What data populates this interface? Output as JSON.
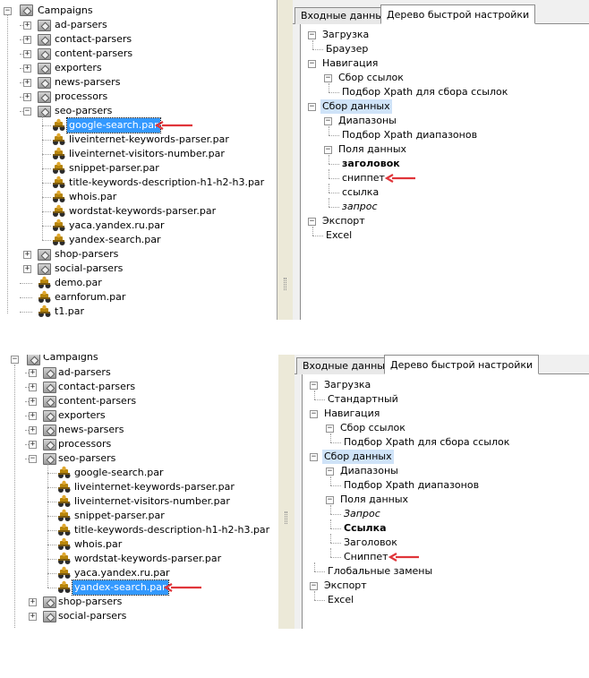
{
  "top": {
    "left_tree": {
      "root": "Campaigns",
      "folders": [
        "ad-parsers",
        "contact-parsers",
        "content-parsers",
        "exporters",
        "news-parsers",
        "processors",
        "seo-parsers"
      ],
      "seo_children": [
        "google-search.par",
        "liveinternet-keywords-parser.par",
        "liveinternet-visitors-number.par",
        "snippet-parser.par",
        "title-keywords-description-h1-h2-h3.par",
        "whois.par",
        "wordstat-keywords-parser.par",
        "yaca.yandex.ru.par",
        "yandex-search.par"
      ],
      "after_folders": [
        "shop-parsers",
        "social-parsers"
      ],
      "root_files": [
        "demo.par",
        "earnforum.par",
        "t1.par"
      ]
    },
    "tabs": [
      "Входные данные",
      "Дерево быстрой настройки"
    ],
    "settings_tree": [
      {
        "label": "Загрузка",
        "level": 0,
        "expander": true
      },
      {
        "label": "Браузер",
        "level": 1,
        "expander": false
      },
      {
        "label": "Навигация",
        "level": 0,
        "expander": true
      },
      {
        "label": "Сбор ссылок",
        "level": 1,
        "expander": true
      },
      {
        "label": "Подбор Xpath для сбора ссылок",
        "level": 2,
        "expander": false
      },
      {
        "label": "Сбор данных",
        "level": 0,
        "expander": true,
        "style": "highlight"
      },
      {
        "label": "Диапазоны",
        "level": 1,
        "expander": true
      },
      {
        "label": "Подбор Xpath диапазонов",
        "level": 2,
        "expander": false
      },
      {
        "label": "Поля данных",
        "level": 1,
        "expander": true
      },
      {
        "label": "заголовок",
        "level": 2,
        "expander": false,
        "style": "bold"
      },
      {
        "label": "сниппет",
        "level": 2,
        "expander": false
      },
      {
        "label": "ссылка",
        "level": 2,
        "expander": false
      },
      {
        "label": "запрос",
        "level": 2,
        "expander": false,
        "style": "italic"
      },
      {
        "label": "Экспорт",
        "level": 0,
        "expander": true
      },
      {
        "label": "Excel",
        "level": 1,
        "expander": false
      }
    ]
  },
  "bottom": {
    "left_tree": {
      "root": "Campaigns",
      "folders": [
        "ad-parsers",
        "contact-parsers",
        "content-parsers",
        "exporters",
        "news-parsers",
        "processors",
        "seo-parsers"
      ],
      "seo_children": [
        "google-search.par",
        "liveinternet-keywords-parser.par",
        "liveinternet-visitors-number.par",
        "snippet-parser.par",
        "title-keywords-description-h1-h2-h3.par",
        "whois.par",
        "wordstat-keywords-parser.par",
        "yaca.yandex.ru.par",
        "yandex-search.par"
      ],
      "after_folders": [
        "shop-parsers",
        "social-parsers"
      ]
    },
    "tabs": [
      "Входные данные",
      "Дерево быстрой настройки"
    ],
    "settings_tree": [
      {
        "label": "Загрузка",
        "level": 0,
        "expander": true
      },
      {
        "label": "Стандартный",
        "level": 1,
        "expander": false
      },
      {
        "label": "Навигация",
        "level": 0,
        "expander": true
      },
      {
        "label": "Сбор ссылок",
        "level": 1,
        "expander": true
      },
      {
        "label": "Подбор Xpath для сбора ссылок",
        "level": 2,
        "expander": false
      },
      {
        "label": "Сбор данных",
        "level": 0,
        "expander": true,
        "style": "highlight"
      },
      {
        "label": "Диапазоны",
        "level": 1,
        "expander": true
      },
      {
        "label": "Подбор Xpath диапазонов",
        "level": 2,
        "expander": false
      },
      {
        "label": "Поля данных",
        "level": 1,
        "expander": true
      },
      {
        "label": "Запрос",
        "level": 2,
        "expander": false,
        "style": "italic"
      },
      {
        "label": "Ссылка",
        "level": 2,
        "expander": false,
        "style": "bold"
      },
      {
        "label": "Заголовок",
        "level": 2,
        "expander": false
      },
      {
        "label": "Сниппет",
        "level": 2,
        "expander": false
      },
      {
        "label": "Глобальные замены",
        "level": 1,
        "expander": false
      },
      {
        "label": "Экспорт",
        "level": 0,
        "expander": true
      },
      {
        "label": "Excel",
        "level": 1,
        "expander": false
      }
    ]
  },
  "colors": {
    "selection": "#3399ff",
    "arrow": "#e0353a",
    "highlight": "#cfe3f8"
  }
}
